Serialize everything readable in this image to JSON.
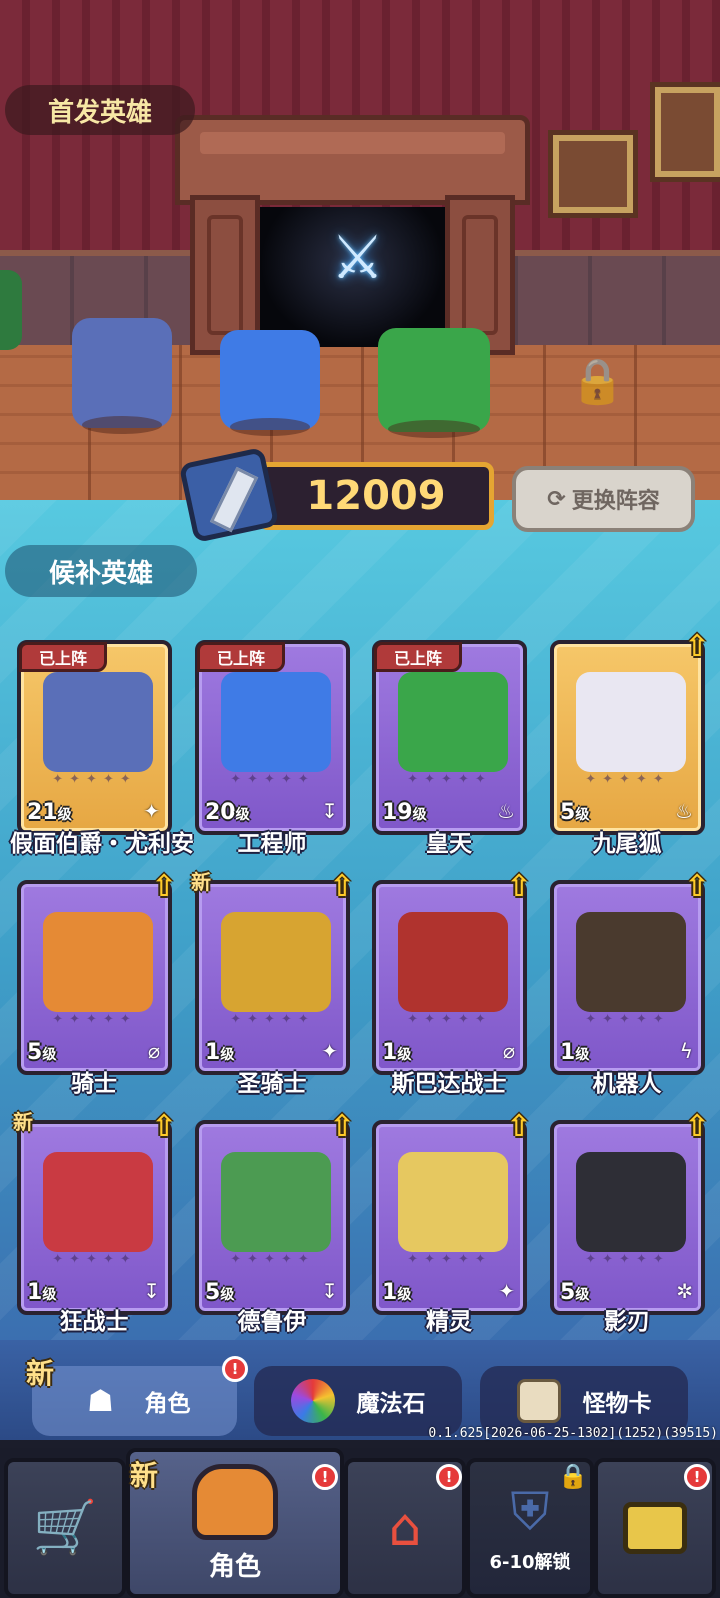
{
  "starter": {
    "title": "首发英雄",
    "power": "12009",
    "swap_label": "更换阵容"
  },
  "bench": {
    "title": "候补英雄",
    "level_suffix": "级",
    "deployed_label": "已上阵",
    "new_label": "新",
    "cards": [
      {
        "name": "假面伯爵・尤利安",
        "level": "21",
        "deployed": true,
        "frame": "gold",
        "element": "sparkle-icon",
        "color": "#5a6fb8"
      },
      {
        "name": "工程师",
        "level": "20",
        "deployed": true,
        "frame": "purple",
        "element": "sword-icon",
        "color": "#3f7be6"
      },
      {
        "name": "皇天",
        "level": "19",
        "deployed": true,
        "frame": "purple",
        "element": "fire-icon",
        "color": "#3aa64a"
      },
      {
        "name": "九尾狐",
        "level": "5",
        "upgrade": true,
        "frame": "gold",
        "element": "fire-icon",
        "color": "#e9e7f2"
      },
      {
        "name": "骑士",
        "level": "5",
        "upgrade": true,
        "frame": "purple",
        "element": "null-icon",
        "color": "#e58a35"
      },
      {
        "name": "圣骑士",
        "level": "1",
        "upgrade": true,
        "new": true,
        "frame": "purple",
        "element": "sparkle-icon",
        "color": "#d7a431"
      },
      {
        "name": "斯巴达战士",
        "level": "1",
        "upgrade": true,
        "frame": "purple",
        "element": "null-icon",
        "color": "#b0332e"
      },
      {
        "name": "机器人",
        "level": "1",
        "upgrade": true,
        "frame": "purple",
        "element": "lightning-icon",
        "color": "#4a3a2e"
      },
      {
        "name": "狂战士",
        "level": "1",
        "upgrade": true,
        "new": true,
        "frame": "purple",
        "element": "sword-icon",
        "color": "#c93a42"
      },
      {
        "name": "德鲁伊",
        "level": "5",
        "upgrade": true,
        "frame": "purple",
        "element": "sword-icon",
        "color": "#4c9b52"
      },
      {
        "name": "精灵",
        "level": "1",
        "upgrade": true,
        "frame": "purple",
        "element": "sparkle-icon",
        "color": "#e6c860"
      },
      {
        "name": "影刃",
        "level": "5",
        "upgrade": true,
        "frame": "purple",
        "element": "orb-icon",
        "color": "#2e2e36"
      }
    ]
  },
  "subtabs": [
    {
      "label": "角色",
      "icon": "ghost-icon",
      "new": "新",
      "badge": "!"
    },
    {
      "label": "魔法石",
      "icon": "gem-icon"
    },
    {
      "label": "怪物卡",
      "icon": "card-icon"
    }
  ],
  "version": "0.1.625[2026-06-25-1302](1252)(39515)",
  "nav": [
    {
      "label": "",
      "icon": "cart-icon"
    },
    {
      "label": "角色",
      "icon": "knight-helmet-icon",
      "new": "新",
      "badge": "!"
    },
    {
      "label": "",
      "icon": "house-icon",
      "badge": "!"
    },
    {
      "label": "6-10解锁",
      "icon": "shield-icon"
    },
    {
      "label": "",
      "icon": "robot-icon",
      "badge": "!"
    }
  ]
}
